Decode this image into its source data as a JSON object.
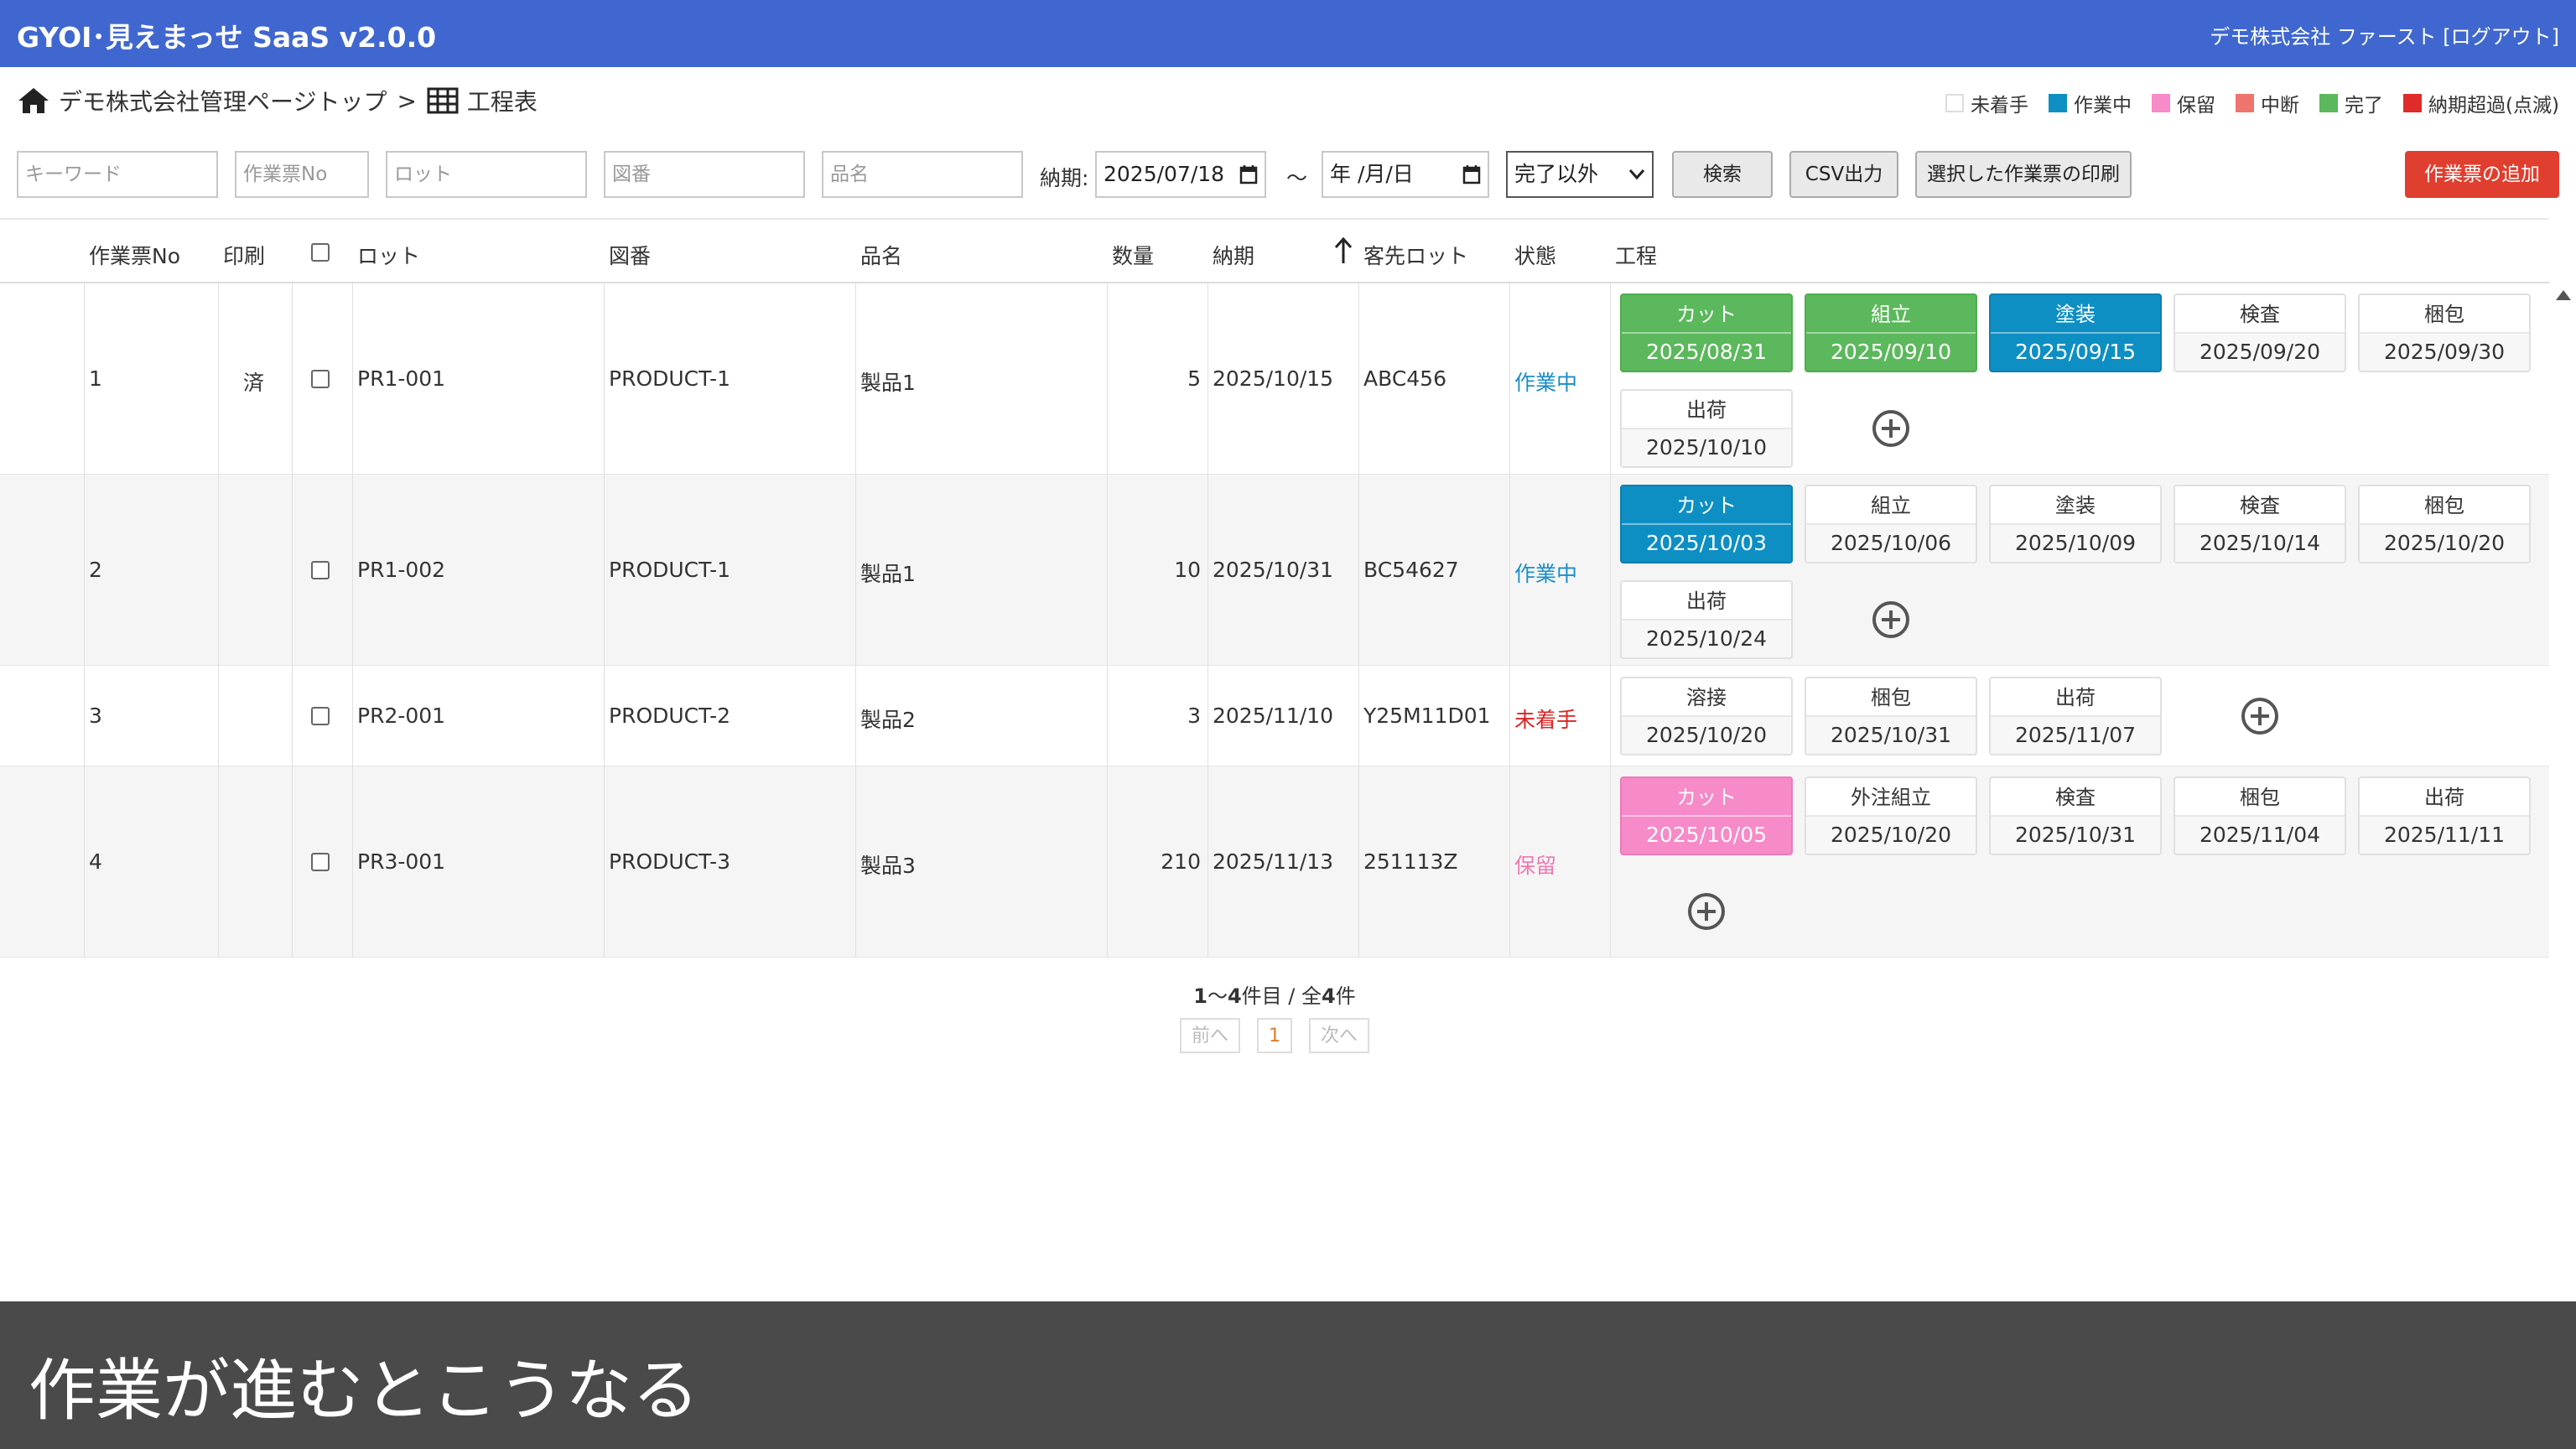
{
  "app": {
    "title": "GYOI･見えまっせ SaaS v2.0.0",
    "account": "デモ株式会社 ファースト [ログアウト]"
  },
  "breadcrumb": {
    "home": "デモ株式会社管理ページトップ",
    "separator": ">",
    "current": "工程表"
  },
  "legend": [
    {
      "label": "未着手",
      "color": "#ffffff"
    },
    {
      "label": "作業中",
      "color": "#0e8fc4"
    },
    {
      "label": "保留",
      "color": "#f78ac8"
    },
    {
      "label": "中断",
      "color": "#f0746e"
    },
    {
      "label": "完了",
      "color": "#5cb85c"
    },
    {
      "label": "納期超過(点滅)",
      "color": "#e02b2b"
    }
  ],
  "filters": {
    "keyword_placeholder": "キーワード",
    "ticket_placeholder": "作業票No",
    "lot_placeholder": "ロット",
    "drawing_placeholder": "図番",
    "product_placeholder": "品名",
    "due_label": "納期:",
    "due_from": "2025/07/18",
    "range_sep": "～",
    "due_to": "年 /月/日",
    "status_selected": "完了以外",
    "search_label": "検索",
    "csv_label": "CSV出力",
    "print_label": "選択した作業票の印刷",
    "add_label": "作業票の追加"
  },
  "columns": {
    "no": "作業票No",
    "print": "印刷",
    "lot": "ロット",
    "drawing": "図番",
    "product": "品名",
    "qty": "数量",
    "due": "納期",
    "client_lot": "客先ロット",
    "status": "状態",
    "process": "工程"
  },
  "rows": [
    {
      "no": "1",
      "print": "済",
      "lot": "PR1-001",
      "drawing": "PRODUCT-1",
      "product": "製品1",
      "qty": "5",
      "due": "2025/10/15",
      "client_lot": "ABC456",
      "status": "作業中",
      "status_key": "wip",
      "processes": [
        {
          "name": "カット",
          "date": "2025/08/31",
          "state": "done"
        },
        {
          "name": "組立",
          "date": "2025/09/10",
          "state": "done"
        },
        {
          "name": "塗装",
          "date": "2025/09/15",
          "state": "wip"
        },
        {
          "name": "検査",
          "date": "2025/09/20",
          "state": "todo"
        },
        {
          "name": "梱包",
          "date": "2025/09/30",
          "state": "todo"
        },
        {
          "name": "出荷",
          "date": "2025/10/10",
          "state": "todo"
        }
      ]
    },
    {
      "no": "2",
      "print": "",
      "lot": "PR1-002",
      "drawing": "PRODUCT-1",
      "product": "製品1",
      "qty": "10",
      "due": "2025/10/31",
      "client_lot": "BC54627",
      "status": "作業中",
      "status_key": "wip",
      "processes": [
        {
          "name": "カット",
          "date": "2025/10/03",
          "state": "wip"
        },
        {
          "name": "組立",
          "date": "2025/10/06",
          "state": "todo"
        },
        {
          "name": "塗装",
          "date": "2025/10/09",
          "state": "todo"
        },
        {
          "name": "検査",
          "date": "2025/10/14",
          "state": "todo"
        },
        {
          "name": "梱包",
          "date": "2025/10/20",
          "state": "todo"
        },
        {
          "name": "出荷",
          "date": "2025/10/24",
          "state": "todo"
        }
      ]
    },
    {
      "no": "3",
      "print": "",
      "lot": "PR2-001",
      "drawing": "PRODUCT-2",
      "product": "製品2",
      "qty": "3",
      "due": "2025/11/10",
      "client_lot": "Y25M11D01",
      "status": "未着手",
      "status_key": "new",
      "processes": [
        {
          "name": "溶接",
          "date": "2025/10/20",
          "state": "todo"
        },
        {
          "name": "梱包",
          "date": "2025/10/31",
          "state": "todo"
        },
        {
          "name": "出荷",
          "date": "2025/11/07",
          "state": "todo"
        }
      ]
    },
    {
      "no": "4",
      "print": "",
      "lot": "PR3-001",
      "drawing": "PRODUCT-3",
      "product": "製品3",
      "qty": "210",
      "due": "2025/11/13",
      "client_lot": "251113Z",
      "status": "保留",
      "status_key": "hold",
      "processes": [
        {
          "name": "カット",
          "date": "2025/10/05",
          "state": "hold"
        },
        {
          "name": "外注組立",
          "date": "2025/10/20",
          "state": "todo"
        },
        {
          "name": "検査",
          "date": "2025/10/31",
          "state": "todo"
        },
        {
          "name": "梱包",
          "date": "2025/11/04",
          "state": "todo"
        },
        {
          "name": "出荷",
          "date": "2025/11/11",
          "state": "todo"
        }
      ]
    }
  ],
  "pagination": {
    "range_from": "1",
    "range_sep": "～",
    "range_to": "4",
    "unit_item": "件目 / 全",
    "total": "4",
    "unit_total": "件",
    "prev": "前へ",
    "current": "1",
    "next": "次へ"
  },
  "caption": "作業が進むとこうなる"
}
